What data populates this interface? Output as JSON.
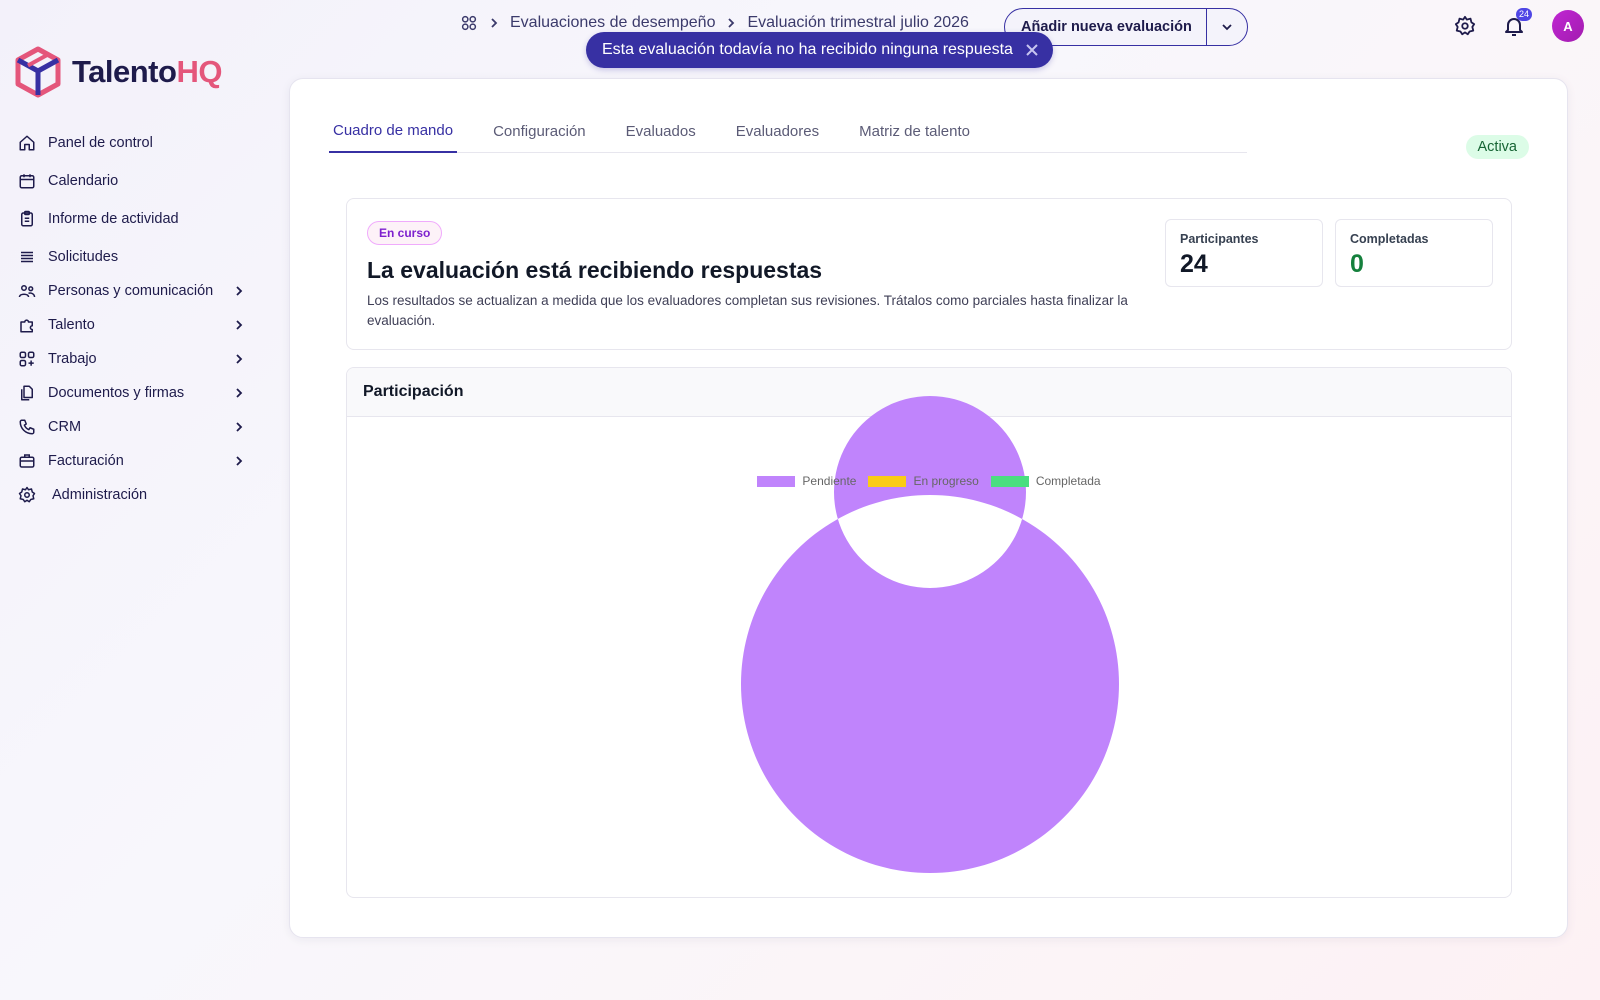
{
  "brand": {
    "name_part1": "Talento",
    "name_part2": "HQ"
  },
  "sidebar": {
    "items": [
      {
        "label": "Panel de control",
        "icon": "home-icon",
        "has_children": false
      },
      {
        "label": "Calendario",
        "icon": "calendar-icon",
        "has_children": false
      },
      {
        "label": "Informe de actividad",
        "icon": "clipboard-icon",
        "has_children": false
      },
      {
        "label": "Solicitudes",
        "icon": "list-icon",
        "has_children": false
      },
      {
        "label": "Personas y comunicación",
        "icon": "people-icon",
        "has_children": true
      },
      {
        "label": "Talento",
        "icon": "puzzle-icon",
        "has_children": true
      },
      {
        "label": "Trabajo",
        "icon": "grid-icon",
        "has_children": true
      },
      {
        "label": "Documentos y firmas",
        "icon": "documents-icon",
        "has_children": true
      },
      {
        "label": "CRM",
        "icon": "phone-icon",
        "has_children": true
      },
      {
        "label": "Facturación",
        "icon": "briefcase-icon",
        "has_children": true
      },
      {
        "label": "Administración",
        "icon": "gear-icon",
        "has_children": false
      }
    ]
  },
  "breadcrumb": {
    "items": [
      "Evaluaciones de desempeño",
      "Evaluación trimestral julio 2026"
    ]
  },
  "actions": {
    "add_evaluation_label": "Añadir nueva evaluación"
  },
  "toast": {
    "message": "Esta evaluación todavía no ha recibido ninguna respuesta"
  },
  "header": {
    "notification_count": "24",
    "avatar_initial": "A"
  },
  "tabs": [
    {
      "label": "Cuadro de mando",
      "active": true
    },
    {
      "label": "Configuración",
      "active": false
    },
    {
      "label": "Evaluados",
      "active": false
    },
    {
      "label": "Evaluadores",
      "active": false
    },
    {
      "label": "Matriz de talento",
      "active": false
    }
  ],
  "status": {
    "label": "Activa"
  },
  "summary": {
    "chip": "En curso",
    "title": "La evaluación está recibiendo respuestas",
    "description": "Los resultados se actualizan a medida que los evaluadores completan sus revisiones. Trátalos como parciales hasta finalizar la evaluación.",
    "stats": [
      {
        "label": "Participantes",
        "value": "24",
        "color": "#111827"
      },
      {
        "label": "Completadas",
        "value": "0",
        "color": "#15803d"
      }
    ]
  },
  "chart_section": {
    "title": "Participación"
  },
  "colors": {
    "primary": "#3730a3",
    "pending": "#c084fc",
    "in_progress": "#facc15",
    "completed": "#4ade80"
  },
  "chart_data": {
    "type": "pie",
    "categories": [
      "Pendiente",
      "En progreso",
      "Completada"
    ],
    "values": [
      24,
      0,
      0
    ],
    "colors": [
      "#c084fc",
      "#facc15",
      "#4ade80"
    ],
    "legend": "top"
  }
}
